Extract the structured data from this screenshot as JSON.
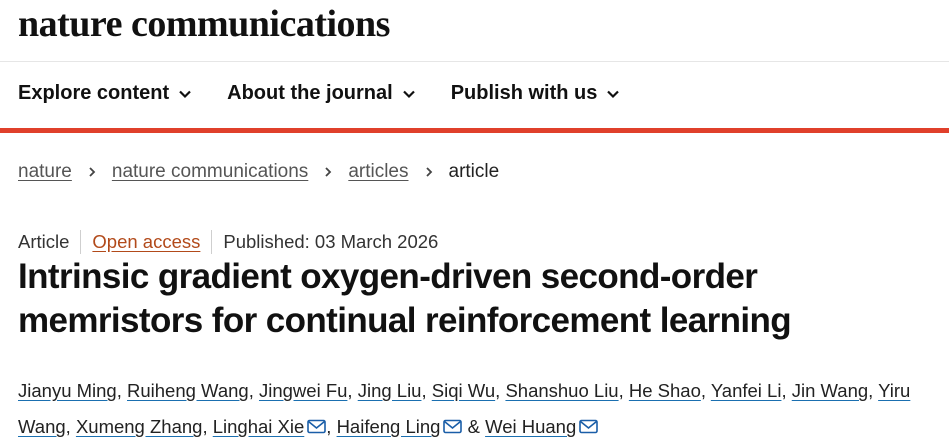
{
  "brand": "nature communications",
  "nav": [
    {
      "label": "Explore content",
      "icon": "chevron-down-icon"
    },
    {
      "label": "About the journal",
      "icon": "chevron-down-icon"
    },
    {
      "label": "Publish with us",
      "icon": "chevron-down-icon"
    }
  ],
  "breadcrumb": [
    "nature",
    "nature communications",
    "articles",
    "article"
  ],
  "meta": {
    "type": "Article",
    "access": "Open access",
    "published": "Published: 03 March 2026"
  },
  "title_lines": [
    "Intrinsic gradient oxygen-driven second-order",
    "memristors for continual reinforcement learning"
  ],
  "authors": {
    "line1": [
      "Jianyu Ming",
      "Ruiheng Wang",
      "Jingwei Fu",
      "Jing Liu",
      "Siqi Wu",
      "Shanshuo Liu",
      "He Shao",
      "Yanfei Li",
      "Jin Wang",
      "Yiru"
    ],
    "line2": [
      "Wang",
      "Xumeng Zhang",
      "Linghai Xie",
      "Haifeng Ling",
      "Wei Huang"
    ],
    "amp": "&"
  },
  "colors": {
    "accent_red": "#e0402b",
    "open_access": "#b24a1a",
    "link_underline": "#1a6fb0"
  }
}
